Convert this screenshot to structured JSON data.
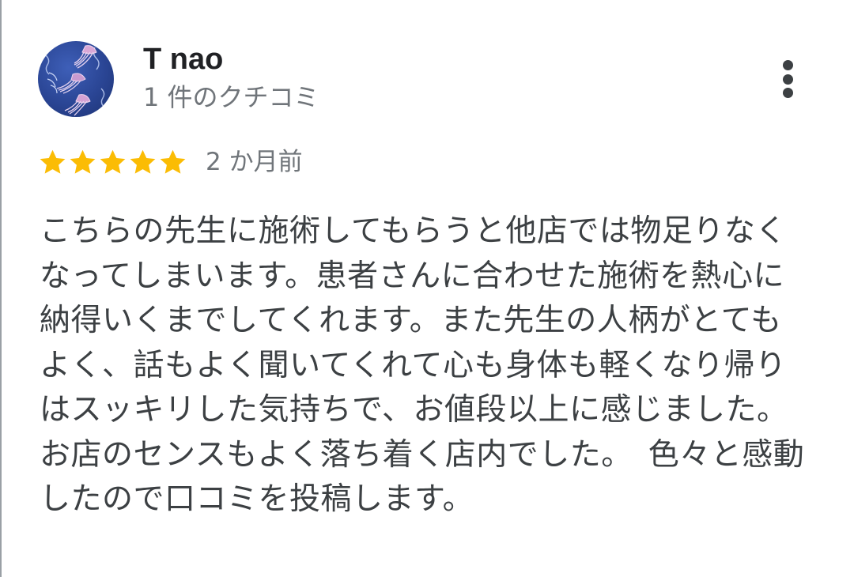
{
  "review": {
    "reviewer": {
      "name": "T nao",
      "review_count": "1 件のクチコミ",
      "avatar_icon": "jellyfish-avatar-icon"
    },
    "more_options_icon": "more-vert-icon",
    "rating": {
      "stars": 5,
      "max_stars": 5,
      "star_color": "#fbbc04",
      "date": "2 か月前"
    },
    "text": "こちらの先生に施術してもらうと他店では物足りなくなってしまいます。患者さんに合わせた施術を熱心に納得いくまでしてくれます。また先生の人柄がとてもよく、話もよく聞いてくれて心も身体も軽くなり帰りはスッキリした気持ちで、お値段以上に感じました。お店のセンスもよく落ち着く店内でした。　色々と感動したので口コミを投稿します。"
  },
  "colors": {
    "name_text": "#202124",
    "secondary_text": "#70757a",
    "body_text": "#3c4043",
    "avatar_background": "#2a4594"
  }
}
